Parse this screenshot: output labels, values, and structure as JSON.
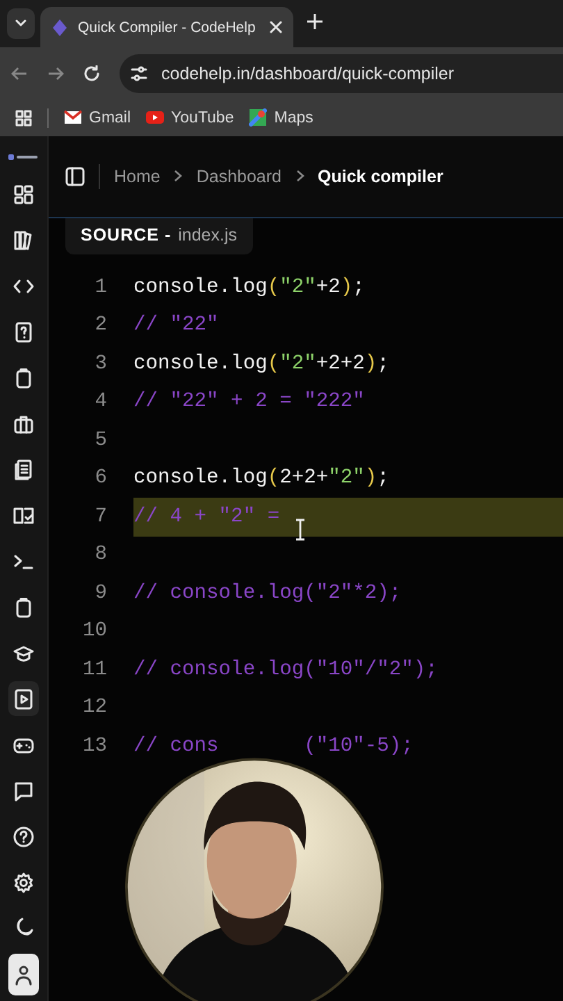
{
  "browser": {
    "tab_title": "Quick Compiler - CodeHelp",
    "url": "codehelp.in/dashboard/quick-compiler",
    "bookmarks": [
      {
        "label": "Gmail",
        "kind": "gmail"
      },
      {
        "label": "YouTube",
        "kind": "youtube"
      },
      {
        "label": "Maps",
        "kind": "maps"
      }
    ]
  },
  "sidebar": {
    "items": [
      {
        "kind": "dashboard",
        "selected": false
      },
      {
        "kind": "library",
        "selected": false
      },
      {
        "kind": "code",
        "selected": false
      },
      {
        "kind": "quiz",
        "selected": false
      },
      {
        "kind": "clipboard",
        "selected": false
      },
      {
        "kind": "briefcase",
        "selected": false
      },
      {
        "kind": "notes",
        "selected": false
      },
      {
        "kind": "book",
        "selected": false
      },
      {
        "kind": "terminal",
        "selected": false
      },
      {
        "kind": "clipboard",
        "selected": false
      },
      {
        "kind": "graduation",
        "selected": false
      },
      {
        "kind": "compiler",
        "selected": true
      },
      {
        "kind": "gamepad",
        "selected": false
      },
      {
        "kind": "chat",
        "selected": false
      },
      {
        "kind": "help",
        "selected": false
      },
      {
        "kind": "settings",
        "selected": false
      },
      {
        "kind": "moon",
        "selected": false
      },
      {
        "kind": "profile",
        "selected": false
      }
    ]
  },
  "breadcrumbs": [
    {
      "label": "Home",
      "current": false
    },
    {
      "label": "Dashboard",
      "current": false
    },
    {
      "label": "Quick compiler",
      "current": true
    }
  ],
  "editor": {
    "tab_label": "SOURCE -",
    "file_name": "index.js",
    "lines": [
      {
        "number": "1",
        "active": false,
        "tokens": [
          {
            "text": "console.log",
            "kind": "plain"
          },
          {
            "text": "(",
            "kind": "paren"
          },
          {
            "text": "\"2\"",
            "kind": "string"
          },
          {
            "text": "+2",
            "kind": "plain"
          },
          {
            "text": ")",
            "kind": "paren"
          },
          {
            "text": ";",
            "kind": "plain"
          }
        ]
      },
      {
        "number": "2",
        "active": false,
        "tokens": [
          {
            "text": "// \"22\"",
            "kind": "comment"
          }
        ]
      },
      {
        "number": "3",
        "active": false,
        "tokens": [
          {
            "text": "console.log",
            "kind": "plain"
          },
          {
            "text": "(",
            "kind": "paren"
          },
          {
            "text": "\"2\"",
            "kind": "string"
          },
          {
            "text": "+2+2",
            "kind": "plain"
          },
          {
            "text": ")",
            "kind": "paren"
          },
          {
            "text": ";",
            "kind": "plain"
          }
        ]
      },
      {
        "number": "4",
        "active": false,
        "tokens": [
          {
            "text": "// \"22\" + 2 = \"222\"",
            "kind": "comment"
          }
        ]
      },
      {
        "number": "5",
        "active": false
      },
      {
        "number": "6",
        "active": false,
        "tokens": [
          {
            "text": "console.log",
            "kind": "plain"
          },
          {
            "text": "(",
            "kind": "paren"
          },
          {
            "text": "2+2+",
            "kind": "plain"
          },
          {
            "text": "\"2\"",
            "kind": "string"
          },
          {
            "text": ")",
            "kind": "paren"
          },
          {
            "text": ";",
            "kind": "plain"
          }
        ]
      },
      {
        "number": "7",
        "active": true,
        "tokens": [
          {
            "text": "// 4 + \"2\" =",
            "kind": "comment"
          }
        ]
      },
      {
        "number": "8",
        "active": false
      },
      {
        "number": "9",
        "active": false,
        "tokens": [
          {
            "text": "// console.log(\"2\"*2);",
            "kind": "comment"
          }
        ]
      },
      {
        "number": "10",
        "active": false
      },
      {
        "number": "11",
        "active": false,
        "tokens": [
          {
            "text": "// console.log(\"10\"/\"2\");",
            "kind": "comment"
          }
        ]
      },
      {
        "number": "12",
        "active": false
      },
      {
        "number": "13",
        "active": false,
        "tokens": [
          {
            "text": "// cons",
            "kind": "comment"
          },
          {
            "kind": "covered"
          },
          {
            "text": "(\"10\"-5);",
            "kind": "comment"
          }
        ]
      }
    ]
  }
}
